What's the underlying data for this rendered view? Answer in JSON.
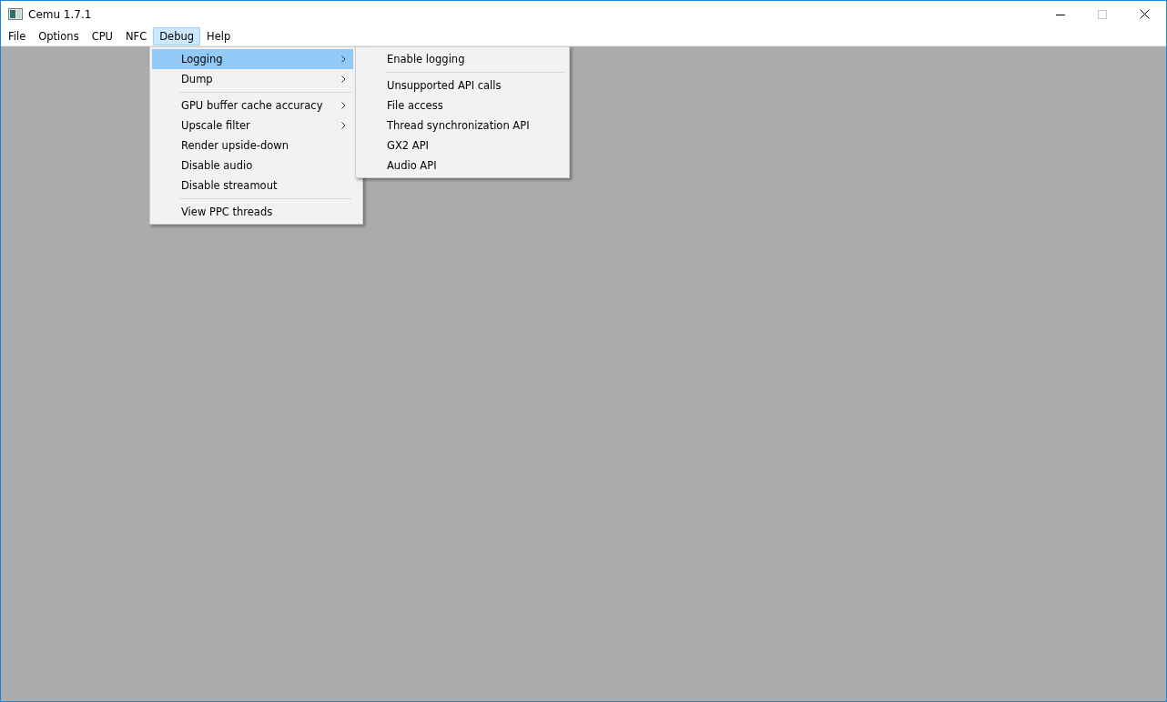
{
  "window": {
    "title": "Cemu 1.7.1"
  },
  "menubar": [
    {
      "label": "File",
      "selected": false
    },
    {
      "label": "Options",
      "selected": false
    },
    {
      "label": "CPU",
      "selected": false
    },
    {
      "label": "NFC",
      "selected": false
    },
    {
      "label": "Debug",
      "selected": true
    },
    {
      "label": "Help",
      "selected": false
    }
  ],
  "debug_menu": [
    {
      "kind": "item",
      "label": "Logging",
      "has_submenu": true,
      "selected": true
    },
    {
      "kind": "item",
      "label": "Dump",
      "has_submenu": true,
      "selected": false
    },
    {
      "kind": "separator"
    },
    {
      "kind": "item",
      "label": "GPU buffer cache accuracy",
      "has_submenu": true,
      "selected": false
    },
    {
      "kind": "item",
      "label": "Upscale filter",
      "has_submenu": true,
      "selected": false
    },
    {
      "kind": "item",
      "label": "Render upside-down",
      "has_submenu": false,
      "selected": false
    },
    {
      "kind": "item",
      "label": "Disable audio",
      "has_submenu": false,
      "selected": false
    },
    {
      "kind": "item",
      "label": "Disable streamout",
      "has_submenu": false,
      "selected": false
    },
    {
      "kind": "separator"
    },
    {
      "kind": "item",
      "label": "View PPC threads",
      "has_submenu": false,
      "selected": false
    }
  ],
  "logging_submenu": [
    {
      "kind": "item",
      "label": "Enable logging",
      "has_submenu": false,
      "selected": false
    },
    {
      "kind": "separator"
    },
    {
      "kind": "item",
      "label": "Unsupported API calls",
      "has_submenu": false,
      "selected": false
    },
    {
      "kind": "item",
      "label": "File access",
      "has_submenu": false,
      "selected": false
    },
    {
      "kind": "item",
      "label": "Thread synchronization API",
      "has_submenu": false,
      "selected": false
    },
    {
      "kind": "item",
      "label": "GX2 API",
      "has_submenu": false,
      "selected": false
    },
    {
      "kind": "item",
      "label": "Audio API",
      "has_submenu": false,
      "selected": false
    }
  ]
}
